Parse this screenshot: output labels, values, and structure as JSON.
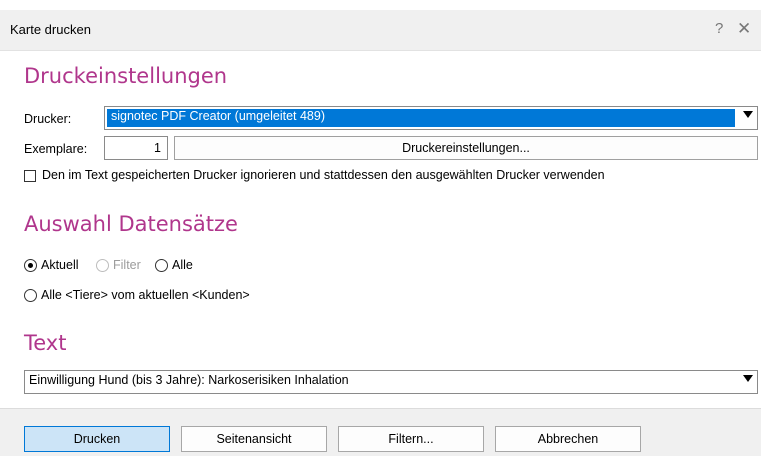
{
  "window": {
    "title": "Karte drucken",
    "help_label": "?",
    "close_label": "✕"
  },
  "druck": {
    "heading": "Druckeinstellungen",
    "printer_label": "Drucker:",
    "printer_value": "signotec PDF Creator (umgeleitet 489)",
    "copies_label": "Exemplare:",
    "copies_value": "1",
    "settings_button": "Druckereinstellungen...",
    "ignore_checkbox_label": "Den im Text gespeicherten Drucker ignorieren und stattdessen den ausgewählten Drucker verwenden",
    "ignore_checked": false
  },
  "auswahl": {
    "heading": "Auswahl Datensätze",
    "radio_aktuell": "Aktuell",
    "radio_filter": "Filter",
    "radio_alle": "Alle",
    "radio_alle_tiere": "Alle <Tiere> vom aktuellen <Kunden>",
    "selected": "Aktuell"
  },
  "text": {
    "heading": "Text",
    "value": "Einwilligung Hund (bis 3 Jahre): Narkoserisiken Inhalation"
  },
  "footer": {
    "print": "Drucken",
    "preview": "Seitenansicht",
    "filter": "Filtern...",
    "cancel": "Abbrechen"
  }
}
